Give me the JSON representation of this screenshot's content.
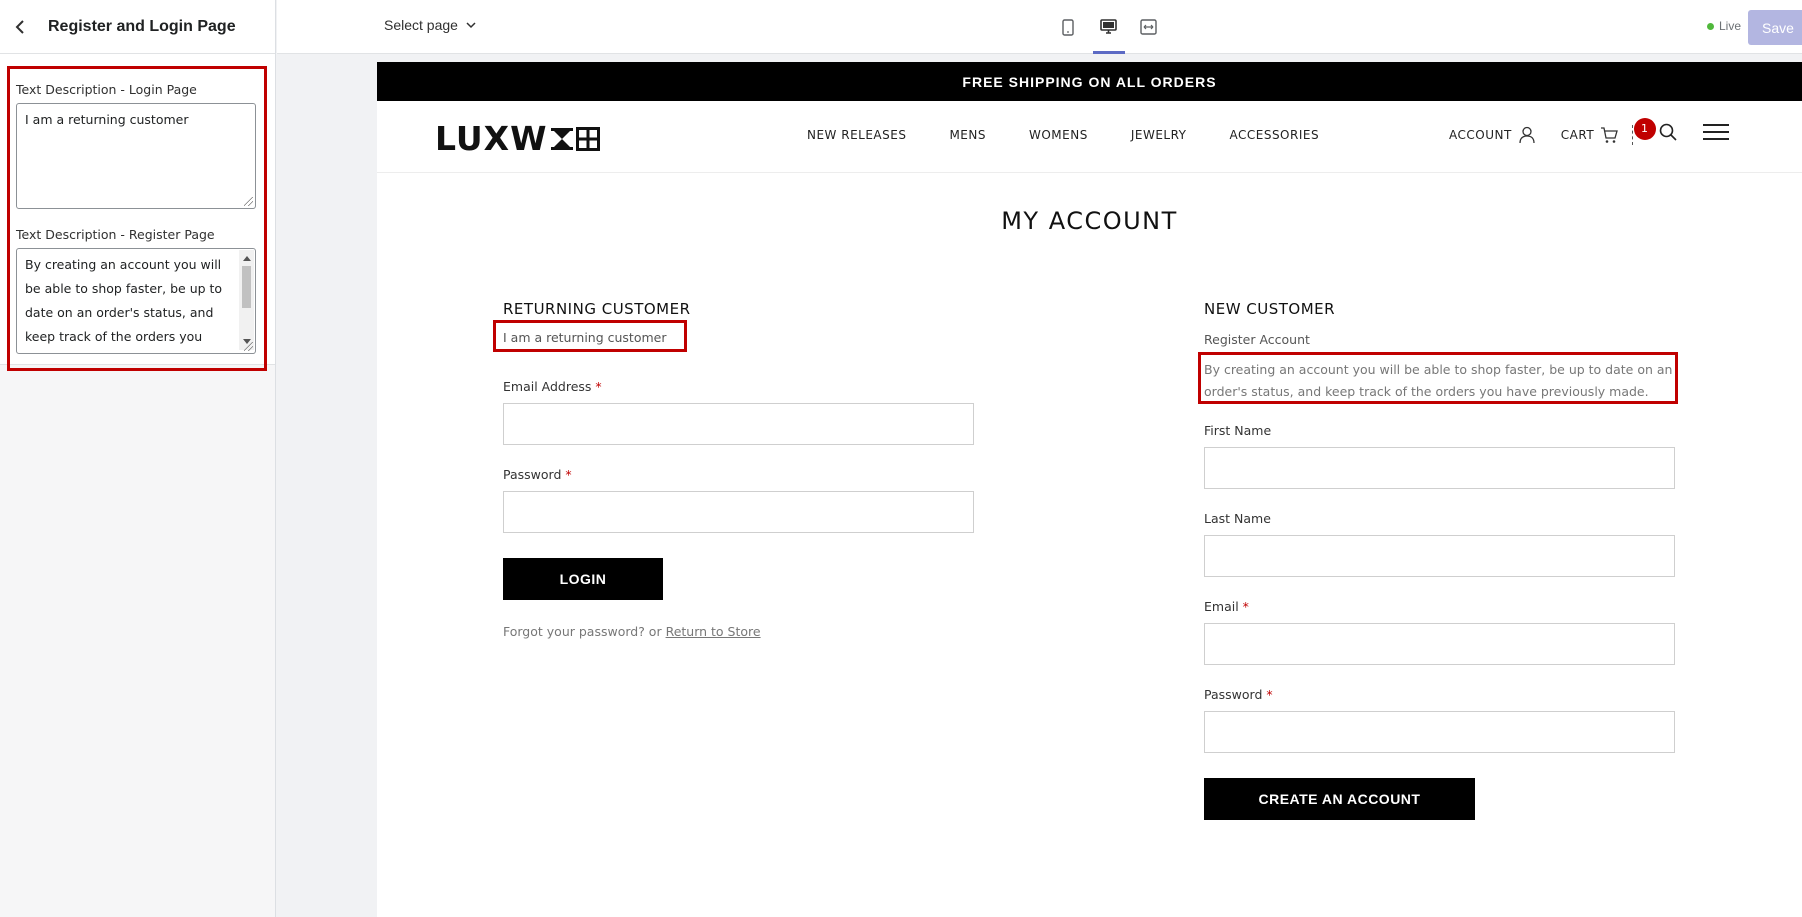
{
  "sidebar": {
    "title": "Register and Login Page",
    "login_label": "Text Description - Login Page",
    "login_value": "I am a returning customer",
    "register_label": "Text Description - Register Page",
    "register_value": "By creating an account you will be able to shop faster, be up to date on an order's status, and keep track of the orders you have previously made."
  },
  "topbar": {
    "page_select": "Select page",
    "live_label": "Live",
    "save_label": "Save",
    "devices": [
      "mobile-icon",
      "desktop-icon",
      "fullwidth-icon"
    ],
    "active_device": "desktop-icon"
  },
  "store": {
    "announcement": "FREE SHIPPING ON ALL ORDERS",
    "logo_text": "LUXW",
    "nav": [
      "NEW RELEASES",
      "MENS",
      "WOMENS",
      "JEWELRY",
      "ACCESSORIES"
    ],
    "account_label": "ACCOUNT",
    "cart_label": "CART",
    "cart_count": "1"
  },
  "page": {
    "title": "MY ACCOUNT",
    "returning": {
      "title": "RETURNING CUSTOMER",
      "description": "I am a returning customer",
      "email_label": "Email Address",
      "password_label": "Password",
      "required_mark": "*",
      "login_button": "LOGIN",
      "forgot_text": "Forgot your password? or",
      "return_link": "Return to Store"
    },
    "new": {
      "title": "NEW CUSTOMER",
      "subtitle": "Register Account",
      "description": "By creating an account you will be able to shop faster, be up to date on an order's status, and keep track of the orders you have previously made.",
      "first_name_label": "First Name",
      "last_name_label": "Last Name",
      "email_label": "Email",
      "password_label": "Password",
      "required_mark": "*",
      "create_button": "CREATE AN ACCOUNT"
    }
  },
  "colors": {
    "highlight": "#c00000",
    "accent": "#5c6ac4",
    "save_disabled": "#b3b6e1",
    "live": "#50b83c"
  }
}
